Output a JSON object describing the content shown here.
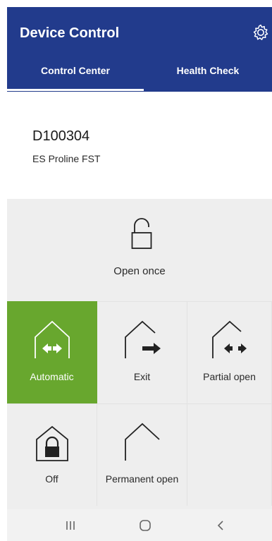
{
  "header": {
    "title": "Device Control",
    "settings_icon": "gear-icon"
  },
  "tabs": [
    {
      "label": "Control Center",
      "active": true
    },
    {
      "label": "Health Check",
      "active": false
    }
  ],
  "device": {
    "id": "D100304",
    "model": "ES Proline FST"
  },
  "actions": {
    "open_once": {
      "label": "Open once",
      "icon": "unlock-icon"
    }
  },
  "modes": [
    {
      "label": "Automatic",
      "icon": "automatic-icon",
      "active": true
    },
    {
      "label": "Exit",
      "icon": "exit-icon",
      "active": false
    },
    {
      "label": "Partial open",
      "icon": "partial-open-icon",
      "active": false
    },
    {
      "label": "Off",
      "icon": "locked-house-icon",
      "active": false
    },
    {
      "label": "Permanent open",
      "icon": "permanent-open-icon",
      "active": false
    }
  ],
  "navbar": {
    "recent_icon": "recent-apps-icon",
    "home_icon": "home-icon",
    "back_icon": "back-icon"
  },
  "colors": {
    "header": "#223b8c",
    "active_mode": "#68a72e",
    "tile": "#eeeeee"
  }
}
